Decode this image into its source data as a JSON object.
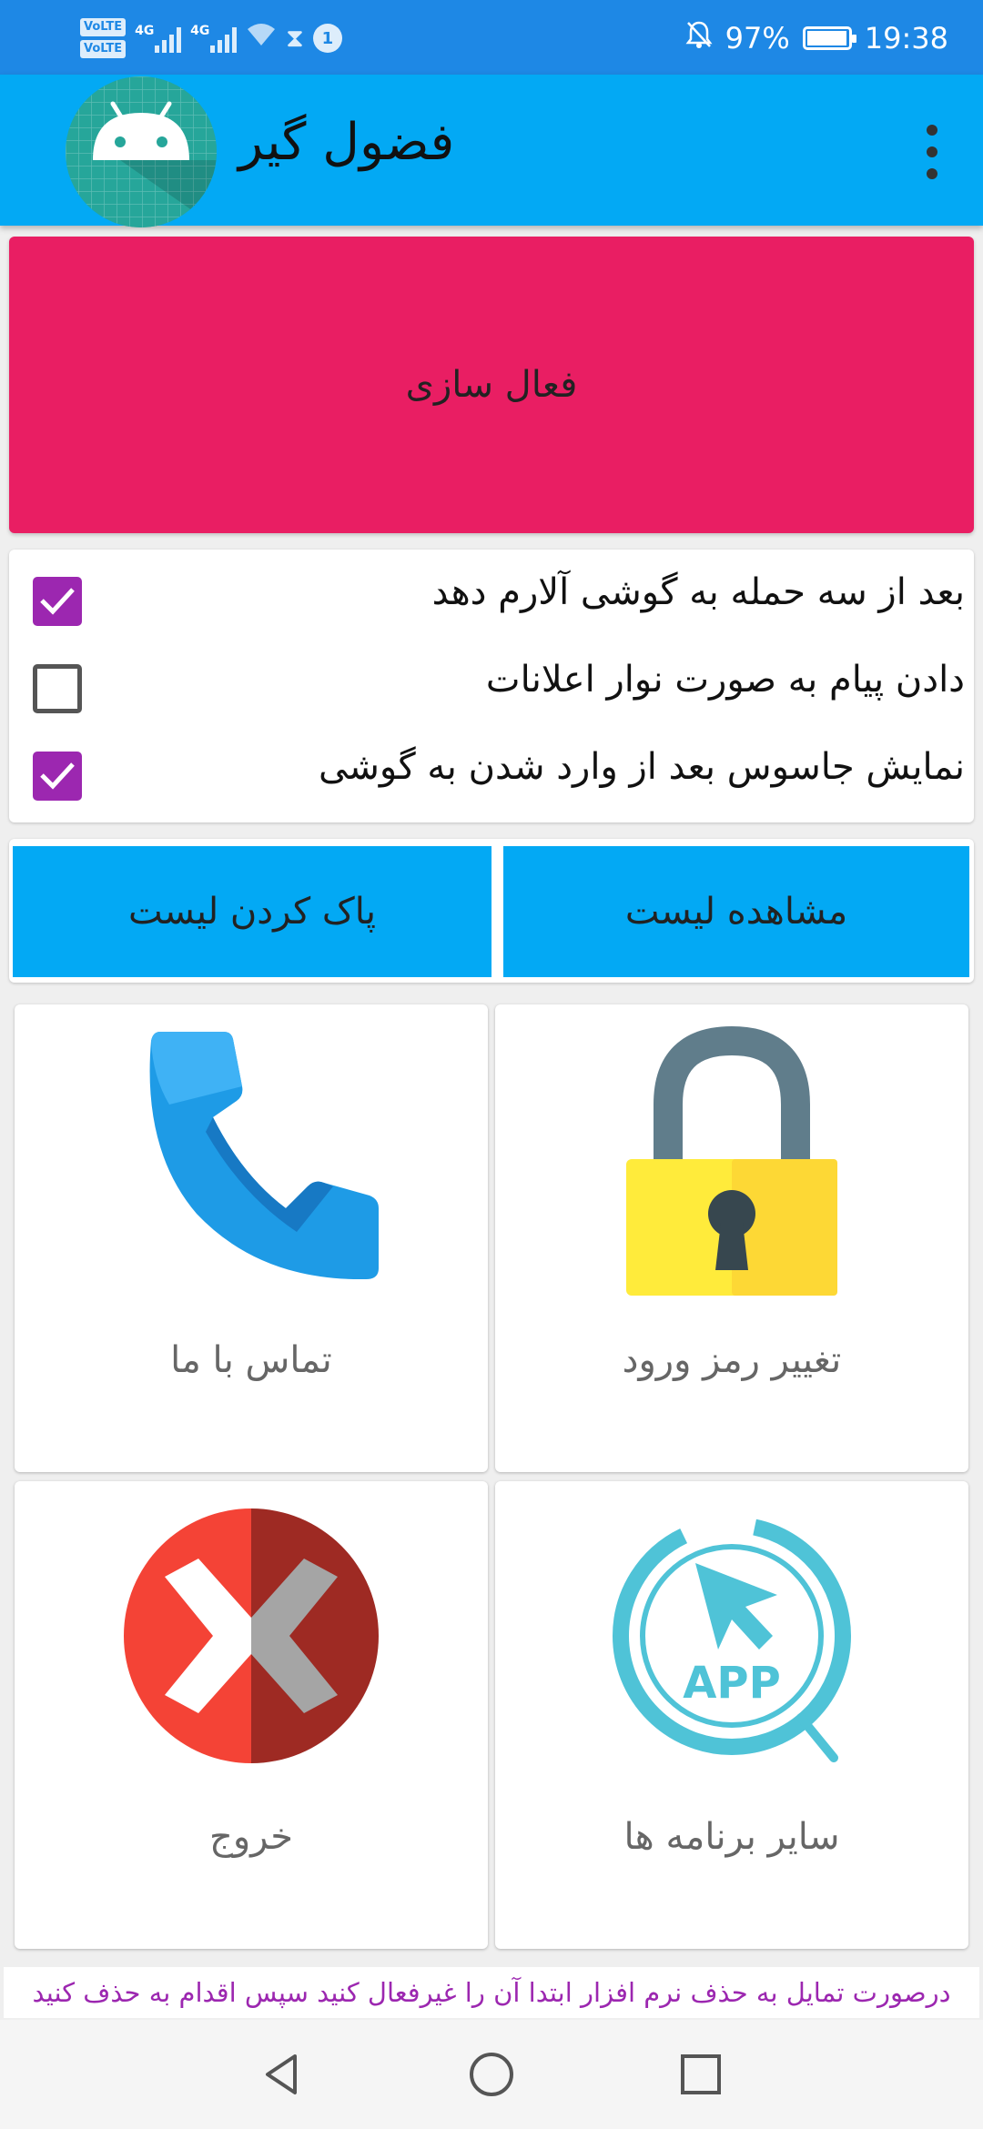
{
  "status_bar": {
    "volte_1": "VoLTE",
    "volte_2": "VoLTE",
    "network_1": "4G",
    "network_2": "4G",
    "notification_count": "1",
    "battery": "97%",
    "time": "19:38"
  },
  "app_bar": {
    "title": "فضول گیر"
  },
  "activate_button": {
    "label": "فعال سازی"
  },
  "options": [
    {
      "label": "بعد از سه حمله به گوشی آلارم دهد",
      "checked": true
    },
    {
      "label": "دادن پیام به صورت نوار اعلانات",
      "checked": false
    },
    {
      "label": "نمایش جاسوس بعد از وارد شدن به گوشی",
      "checked": true
    }
  ],
  "list_buttons": {
    "view": "مشاهده لیست",
    "clear": "پاک کردن لیست"
  },
  "tiles": {
    "contact": "تماس با ما",
    "change_password": "تغییر رمز ورود",
    "exit": "خروج",
    "other_apps": "سایر برنامه ها",
    "app_logo_text": "APP"
  },
  "notice": "درصورت تمایل به حذف نرم افزار ابتدا آن را غیرفعال کنید سپس اقدام به حذف کنید",
  "colors": {
    "status_bar": "#1e88e5",
    "app_bar": "#03a9f4",
    "activate": "#e91e63",
    "checkbox_on": "#9c27b0",
    "notice_text": "#9c27b0"
  }
}
